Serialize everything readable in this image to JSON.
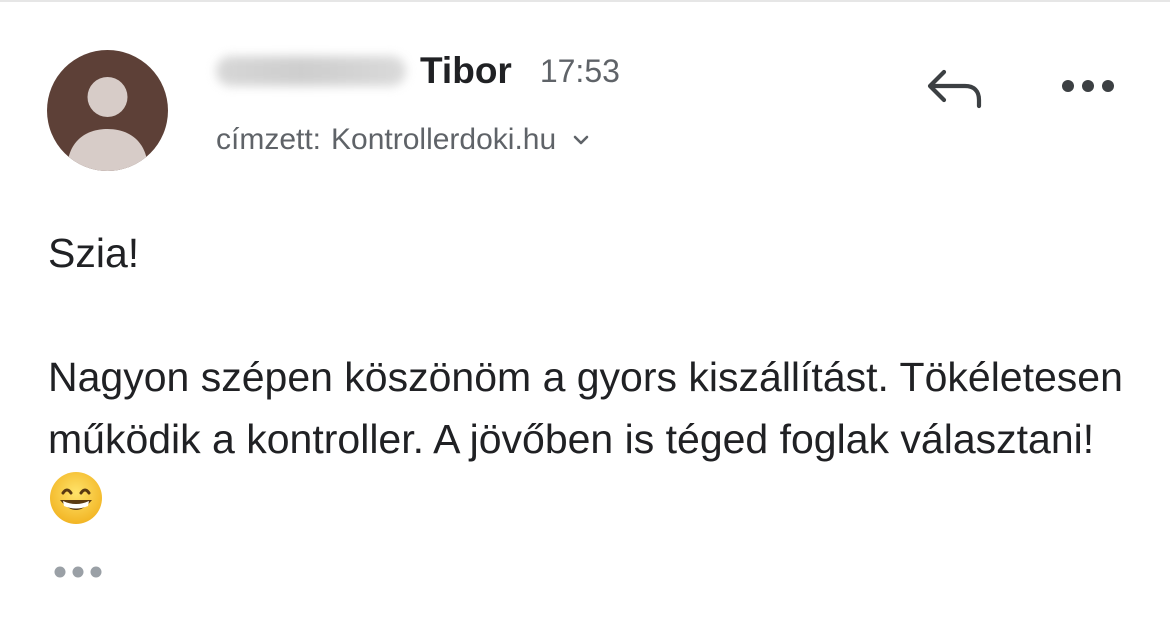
{
  "email": {
    "sender": {
      "name_visible": "Tibor",
      "time": "17:53",
      "avatar_icon": "person-avatar-icon",
      "avatar_bg_color": "#5d4037",
      "avatar_fg_color": "#d7ccc8"
    },
    "recipient": {
      "prefix": "címzett:",
      "value": "Kontrollerdoki.hu",
      "expand_icon": "chevron-down-icon"
    },
    "actions": {
      "reply_icon": "reply-icon",
      "more_icon": "more-horizontal-icon"
    },
    "body": {
      "greeting": "Szia!",
      "paragraph": "Nagyon szépen köszönöm a gyors kiszállítást. Tökéletesen működik a kontroller. A jövőben is téged foglak választani!",
      "emoji_icon": "grinning-face-emoji"
    },
    "trimmed_content_icon": "ellipsis-icon"
  }
}
